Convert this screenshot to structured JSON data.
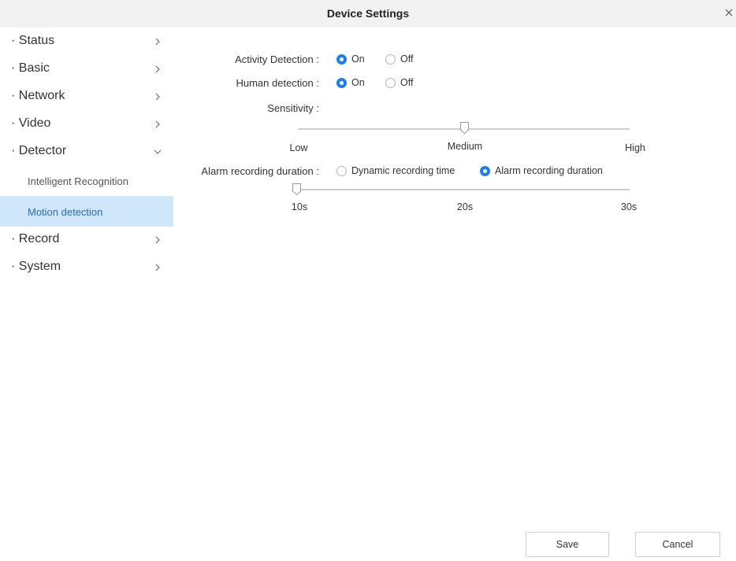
{
  "window": {
    "title": "Device Settings",
    "close_glyph": "×"
  },
  "sidebar": {
    "items": [
      {
        "label": "· Status"
      },
      {
        "label": "· Basic"
      },
      {
        "label": "· Network"
      },
      {
        "label": "· Video"
      },
      {
        "label": "· Detector"
      },
      {
        "label": "· Record"
      },
      {
        "label": "· System"
      }
    ],
    "subitems": [
      {
        "label": "Intelligent Recognition"
      },
      {
        "label": "Motion detection",
        "active": true
      }
    ]
  },
  "main": {
    "activity_detection": {
      "label": "Activity Detection :",
      "on": "On",
      "off": "Off",
      "selected": "On"
    },
    "human_detection": {
      "label": "Human detection :",
      "on": "On",
      "off": "Off",
      "selected": "On"
    },
    "sensitivity": {
      "label": "Sensitivity :",
      "low": "Low",
      "medium": "Medium",
      "high": "High",
      "value": "Medium"
    },
    "alarm_recording": {
      "label": "Alarm recording duration :",
      "option_dynamic": "Dynamic recording time",
      "option_duration": "Alarm recording duration",
      "selected": "Alarm recording duration"
    },
    "duration_slider": {
      "min": "10s",
      "mid": "20s",
      "max": "30s",
      "value": "10s"
    }
  },
  "footer": {
    "save_label": "Save",
    "cancel_label": "Cancel"
  },
  "colors": {
    "accent": "#1e7ee8",
    "active_bg": "#cfe6fb",
    "titlebar_bg": "#f2f2f2"
  }
}
